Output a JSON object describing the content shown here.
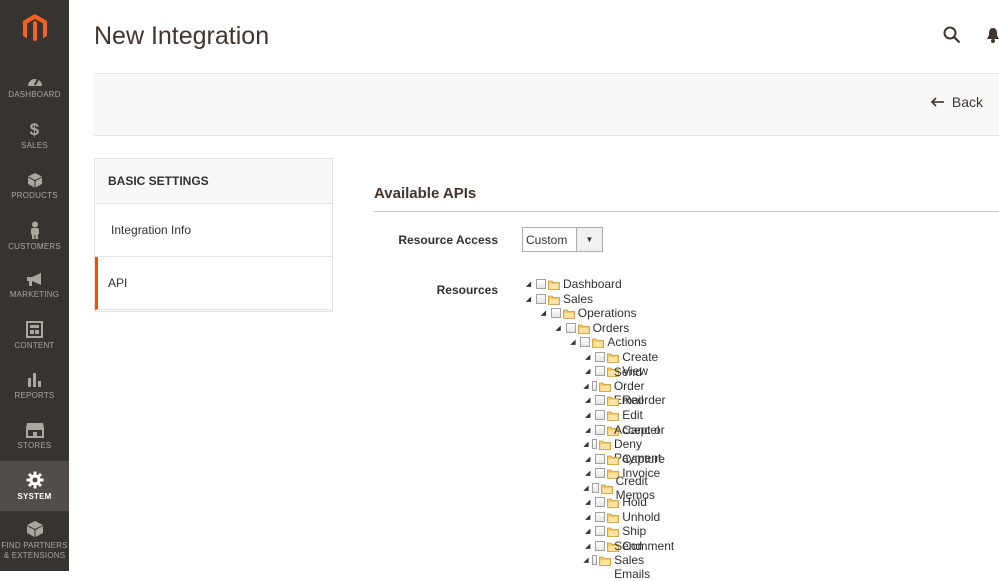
{
  "sidebar": {
    "items": [
      {
        "label": "DASHBOARD",
        "icon": "dashboard-icon"
      },
      {
        "label": "SALES",
        "icon": "dollar-icon"
      },
      {
        "label": "PRODUCTS",
        "icon": "box-icon"
      },
      {
        "label": "CUSTOMERS",
        "icon": "person-icon"
      },
      {
        "label": "MARKETING",
        "icon": "megaphone-icon"
      },
      {
        "label": "CONTENT",
        "icon": "content-icon"
      },
      {
        "label": "REPORTS",
        "icon": "bar-chart-icon"
      },
      {
        "label": "STORES",
        "icon": "store-icon"
      },
      {
        "label": "SYSTEM",
        "icon": "gear-icon",
        "active": true
      },
      {
        "label_line1": "FIND PARTNERS",
        "label_line2": "& EXTENSIONS",
        "icon": "cubes-icon"
      }
    ]
  },
  "header": {
    "title": "New Integration",
    "back_label": "Back"
  },
  "tabs": {
    "title": "BASIC SETTINGS",
    "items": [
      {
        "label": "Integration Info"
      },
      {
        "label": "API",
        "active": true
      }
    ]
  },
  "main": {
    "section_title": "Available APIs",
    "resource_access_label": "Resource Access",
    "resource_access_value": "Custom",
    "resources_label": "Resources",
    "tree": [
      {
        "label": "Dashboard",
        "level": 0
      },
      {
        "label": "Sales",
        "level": 0
      },
      {
        "label": "Operations",
        "level": 1
      },
      {
        "label": "Orders",
        "level": 2
      },
      {
        "label": "Actions",
        "level": 3
      },
      {
        "label": "Create",
        "level": 4
      },
      {
        "label": "View",
        "level": 4
      },
      {
        "label": "Send Order Email",
        "level": 4
      },
      {
        "label": "Reorder",
        "level": 4
      },
      {
        "label": "Edit",
        "level": 4
      },
      {
        "label": "Cancel",
        "level": 4
      },
      {
        "label": "Accept or Deny Payment",
        "level": 4
      },
      {
        "label": "Capture",
        "level": 4
      },
      {
        "label": "Invoice",
        "level": 4
      },
      {
        "label": "Credit Memos",
        "level": 4
      },
      {
        "label": "Hold",
        "level": 4
      },
      {
        "label": "Unhold",
        "level": 4
      },
      {
        "label": "Ship",
        "level": 4
      },
      {
        "label": "Comment",
        "level": 4
      },
      {
        "label": "Send Sales Emails",
        "level": 4
      }
    ]
  },
  "colors": {
    "sidebar_bg": "#373330",
    "sidebar_active": "#524d49",
    "accent": "#eb5202"
  }
}
